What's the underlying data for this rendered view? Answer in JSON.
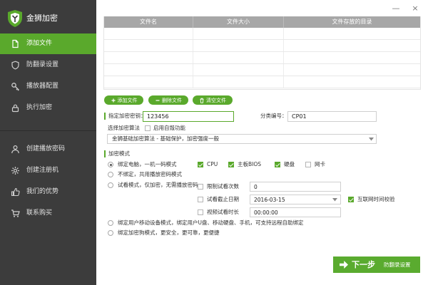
{
  "app": {
    "title": "金狮加密"
  },
  "window_controls": {
    "minimize": "—",
    "close": "×"
  },
  "sidebar": {
    "items": [
      {
        "label": "添加文件",
        "icon": "file-icon",
        "active": true
      },
      {
        "label": "防翻录设置",
        "icon": "shield-icon",
        "active": false
      },
      {
        "label": "播放器配置",
        "icon": "key-icon",
        "active": false
      },
      {
        "label": "执行加密",
        "icon": "lock-icon",
        "active": false
      }
    ],
    "extra_items": [
      {
        "label": "创建播放密码",
        "icon": "user-icon"
      },
      {
        "label": "创建注册机",
        "icon": "gear-icon"
      },
      {
        "label": "我们的优势",
        "icon": "thumbs-up-icon"
      },
      {
        "label": "联系购买",
        "icon": "cart-icon"
      }
    ]
  },
  "file_table": {
    "columns": [
      "文件名",
      "文件大小",
      "文件存放的目录"
    ],
    "rows": []
  },
  "file_actions": {
    "add": "添加文件",
    "delete": "删除文件",
    "clear": "清空文件"
  },
  "key": {
    "label": "指定加密密钥：",
    "value": "123456"
  },
  "category": {
    "label": "分类编号：",
    "value": "CP01"
  },
  "algorithm": {
    "label": "选择加密算法",
    "self_destruct": {
      "label": "启用自毁功能",
      "checked": false
    },
    "selected": "金狮基础加密算法 - 基础保护，加密强度一般"
  },
  "mode": {
    "label": "加密模式",
    "options": [
      {
        "label": "绑定电脑，一机一码模式",
        "selected": true
      },
      {
        "label": "不绑定，共用播放密码模式",
        "selected": false
      },
      {
        "label": "试看模式，仅加密，无需播放密码",
        "selected": false
      },
      {
        "label": "绑定用户移动设备模式，绑定用户U盘、移动硬盘、手机，可支持远程自助绑定",
        "selected": false
      },
      {
        "label": "绑定加密狗模式，更安全，更可靠，更便捷",
        "selected": false
      }
    ],
    "hardware": [
      {
        "label": "CPU",
        "checked": true
      },
      {
        "label": "主板BIOS",
        "checked": true
      },
      {
        "label": "硬盘",
        "checked": true
      },
      {
        "label": "网卡",
        "checked": false
      }
    ],
    "trial": {
      "limit_count": {
        "label": "限制试看次数",
        "checked": false,
        "value": "0"
      },
      "end_date": {
        "label": "试看截止日期",
        "checked": false,
        "value": "2016-03-15"
      },
      "internet_time_check": {
        "label": "互联网时间校验",
        "checked": true
      },
      "duration": {
        "label": "视频试看时长",
        "checked": false,
        "value": "00:00:00"
      }
    }
  },
  "next": {
    "label": "下一步",
    "sub_label": "防翻录设置"
  },
  "colors": {
    "sidebar": "#3c3c3c",
    "accent": "#5aa92c",
    "table_header": "#a7a7a7"
  }
}
